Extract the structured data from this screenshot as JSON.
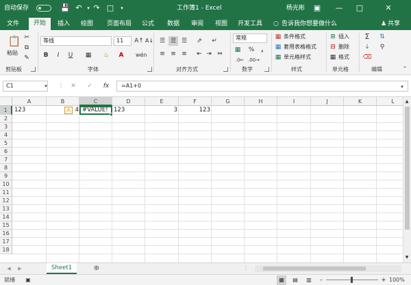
{
  "titlebar": {
    "autosave_label": "自动保存",
    "autosave_state": "关",
    "title": "工作簿1 - Excel",
    "user_name": "杨光彬",
    "accent_color": "#217346"
  },
  "tabs": [
    "文件",
    "开始",
    "插入",
    "绘图",
    "页面布局",
    "公式",
    "数据",
    "审阅",
    "视图",
    "开发工具"
  ],
  "active_tab": "开始",
  "tell_me": "告诉我你想要做什么",
  "share_label": "共享",
  "ribbon": {
    "paste_label": "粘贴",
    "font_name": "等线",
    "font_size": "11",
    "number_format": "常规",
    "cond_format": "条件格式",
    "table_format": "套用表格格式",
    "cell_styles": "单元格样式",
    "insert": "插入",
    "delete": "删除",
    "format": "格式",
    "group_labels": [
      "剪贴板",
      "字体",
      "对齐方式",
      "数字",
      "样式",
      "单元格",
      "编辑"
    ],
    "bold": "B",
    "italic": "I",
    "underline": "U"
  },
  "formula_bar": {
    "name_box": "C1",
    "formula": "=A1+0",
    "fx": "fx"
  },
  "grid": {
    "columns": [
      "A",
      "B",
      "C",
      "D",
      "E",
      "F",
      "G",
      "H",
      "I",
      "J",
      "K",
      "L"
    ],
    "rows": [
      "1",
      "2",
      "3",
      "4",
      "5",
      "6",
      "7",
      "8",
      "9",
      "10",
      "11",
      "12",
      "13",
      "14",
      "15",
      "16",
      "17",
      "18"
    ],
    "selected_cell": "C1",
    "cells": {
      "A1": "123",
      "B1": "4",
      "C1": "#VALUE!",
      "D1": "123",
      "E1": "3",
      "F1": "123"
    }
  },
  "sheet_tab": "Sheet1",
  "status": {
    "ready": "就绪",
    "zoom": "100%"
  }
}
